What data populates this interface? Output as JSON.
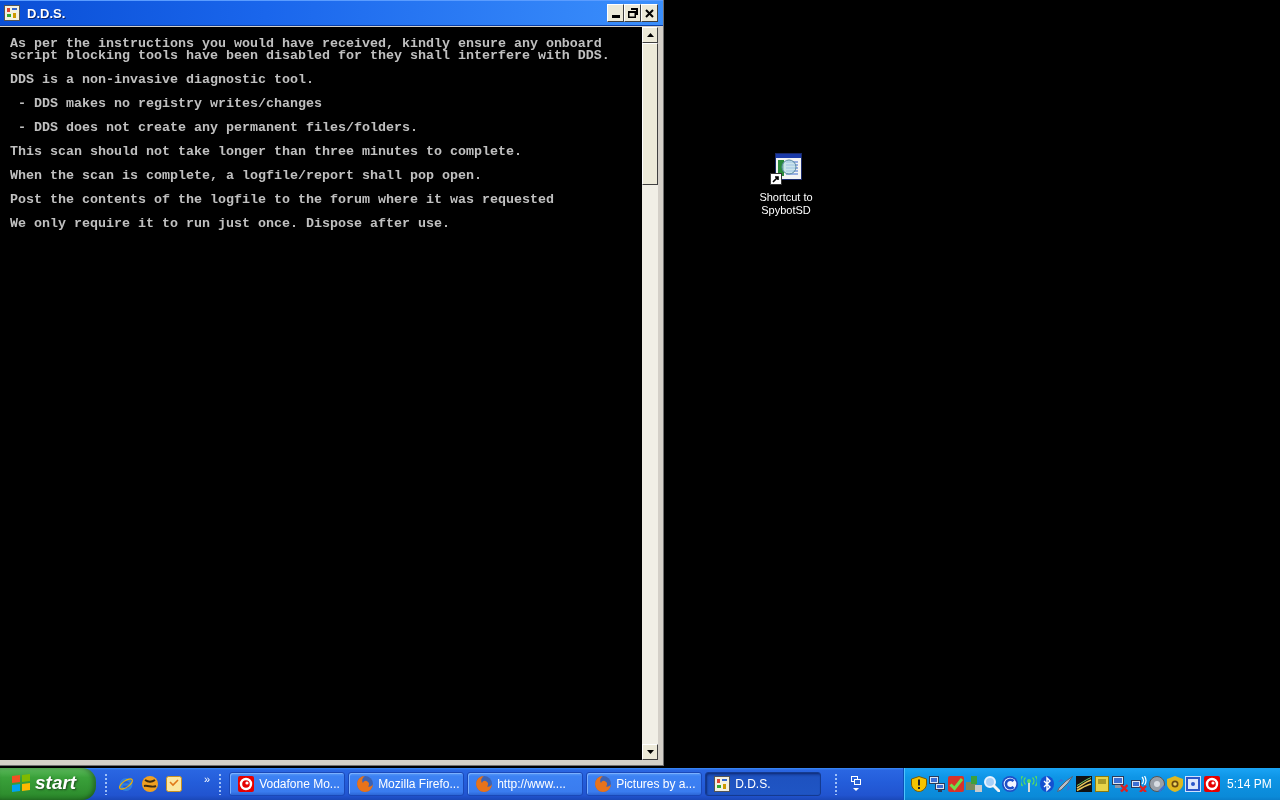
{
  "window": {
    "title": "D.D.S.",
    "console": {
      "paragraphs": [
        {
          "lines": [
            "As per the instructions you would have received, kindly ensure any onboard",
            "script blocking tools have been disabled for they shall interfere with DDS."
          ]
        },
        {
          "lines": [
            "DDS is a non-invasive diagnostic tool."
          ]
        },
        {
          "lines": [
            " - DDS makes no registry writes/changes"
          ]
        },
        {
          "lines": [
            " - DDS does not create any permanent files/folders."
          ]
        },
        {
          "lines": [
            "This scan should not take longer than three minutes to complete."
          ]
        },
        {
          "lines": [
            "When the scan is complete, a logfile/report shall pop open."
          ]
        },
        {
          "lines": [
            "Post the contents of the logfile to the forum where it was requested"
          ]
        },
        {
          "lines": [
            "We only require it to run just once. Dispose after use."
          ]
        }
      ]
    }
  },
  "desktop": {
    "icons": [
      {
        "label": "Shortcut to SpybotSD"
      }
    ]
  },
  "taskbar": {
    "start_button": "start",
    "quick_launch": {
      "overflow": "»"
    },
    "tasks": [
      {
        "label": "Vodafone Mo...",
        "kind": "tile",
        "selected": false
      },
      {
        "label": "Mozilla Firefo...",
        "kind": "globe",
        "selected": false
      },
      {
        "label": "http://www....",
        "kind": "globe",
        "selected": false
      },
      {
        "label": "Pictures by a...",
        "kind": "globe",
        "selected": false
      },
      {
        "label": "D.D.S.",
        "kind": "sheet",
        "selected": true
      }
    ],
    "clock": "5:14 PM"
  }
}
